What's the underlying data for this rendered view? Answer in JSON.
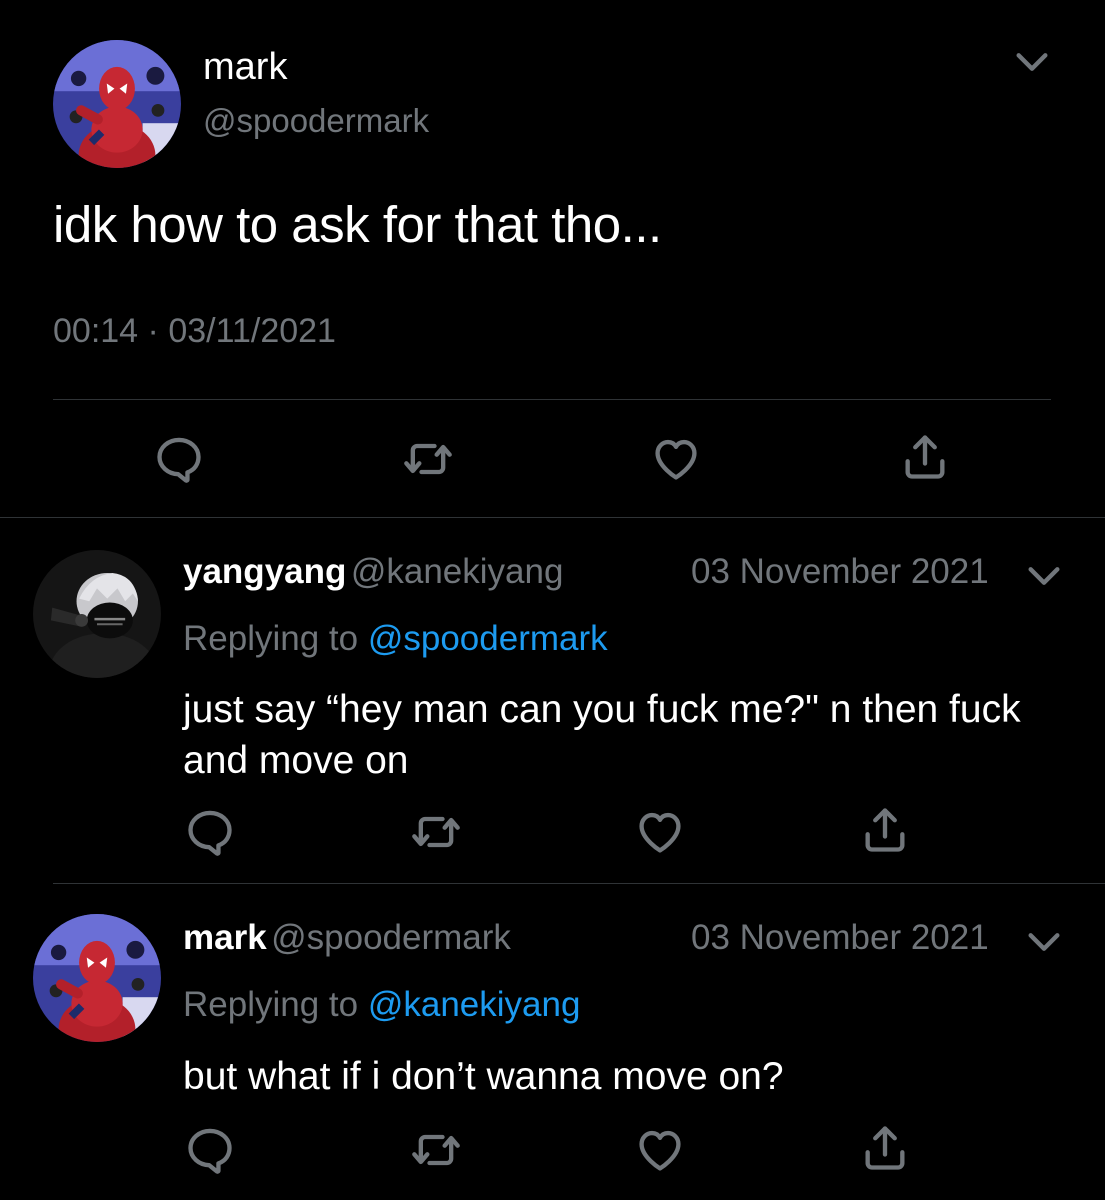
{
  "main_tweet": {
    "author_name": "mark",
    "author_handle": "@spoodermark",
    "text": "idk how to ask for that tho...",
    "time": "00:14",
    "separator": "·",
    "date": "03/11/2021",
    "avatar_icon": "spiderman-avatar",
    "menu_icon": "chevron-down-icon"
  },
  "replies": [
    {
      "author_name": "yangyang",
      "author_handle": "@kanekiyang",
      "date": "03 November 2021",
      "replying_prefix": "Replying to",
      "replying_to": "@spoodermark",
      "text": "just say “hey man can you fuck me?\" n then fuck and move on",
      "avatar_icon": "masked-person-avatar"
    },
    {
      "author_name": "mark",
      "author_handle": "@spoodermark",
      "date": "03 November 2021",
      "replying_prefix": "Replying to",
      "replying_to": "@kanekiyang",
      "text": "but what if i don’t wanna move on?",
      "avatar_icon": "spiderman-avatar"
    }
  ],
  "colors": {
    "background": "#000000",
    "text": "#ffffff",
    "secondary": "#71767b",
    "link": "#1d9bf0",
    "divider": "#2f3336"
  }
}
